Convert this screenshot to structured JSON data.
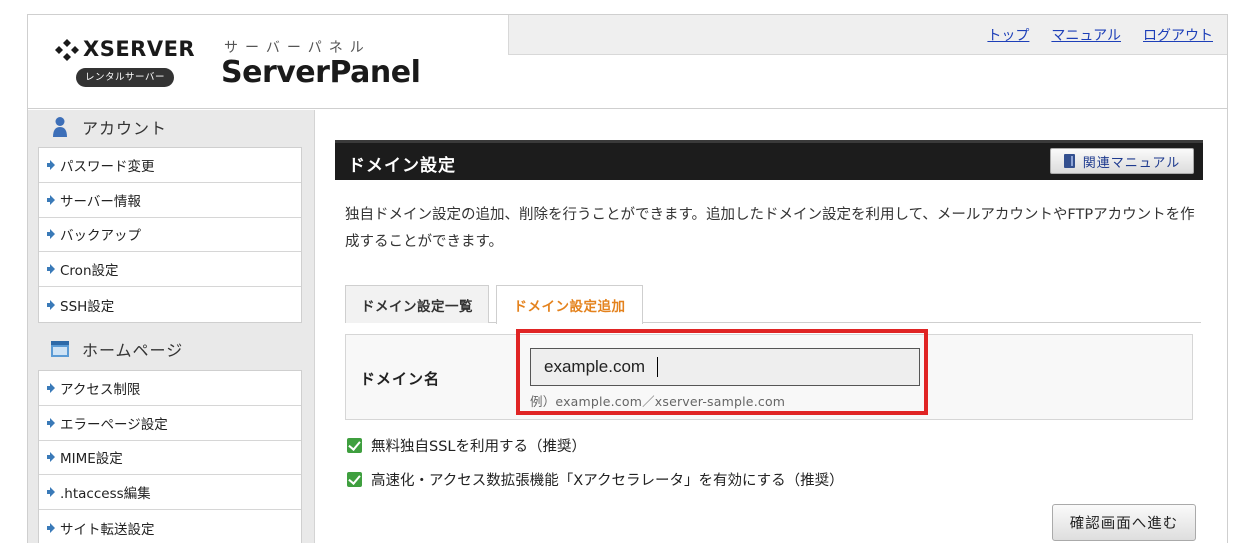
{
  "header": {
    "logo_main": "XSERVER",
    "logo_sub": "レンタルサーバー",
    "panel_kana": "サーバーパネル",
    "panel_title": "ServerPanel",
    "nav": [
      "トップ",
      "マニュアル",
      "ログアウト"
    ]
  },
  "sidebar": {
    "sections": [
      {
        "title": "アカウント",
        "icon": "user-icon",
        "items": [
          "パスワード変更",
          "サーバー情報",
          "バックアップ",
          "Cron設定",
          "SSH設定"
        ]
      },
      {
        "title": "ホームページ",
        "icon": "homepage-icon",
        "items": [
          "アクセス制限",
          "エラーページ設定",
          "MIME設定",
          ".htaccess編集",
          "サイト転送設定"
        ]
      }
    ]
  },
  "main": {
    "title": "ドメイン設定",
    "manual_button": "関連マニュアル",
    "description": "独自ドメイン設定の追加、削除を行うことができます。追加したドメイン設定を利用して、メールアカウントやFTPアカウントを作成することができます。",
    "tabs": [
      {
        "label": "ドメイン設定一覧",
        "active": false
      },
      {
        "label": "ドメイン設定追加",
        "active": true
      }
    ],
    "form": {
      "label": "ドメイン名",
      "value": "example.com",
      "hint": "例）example.com／xserver-sample.com"
    },
    "options": [
      {
        "label": "無料独自SSLを利用する（推奨）",
        "checked": true
      },
      {
        "label": "高速化・アクセス数拡張機能「Xアクセラレータ」を有効にする（推奨）",
        "checked": true
      }
    ],
    "submit": "確認画面へ進む"
  },
  "colors": {
    "active_tab": "#e4821d",
    "highlight": "#e02424",
    "link": "#1d3fb8",
    "checkbox": "#3f9f3f"
  }
}
